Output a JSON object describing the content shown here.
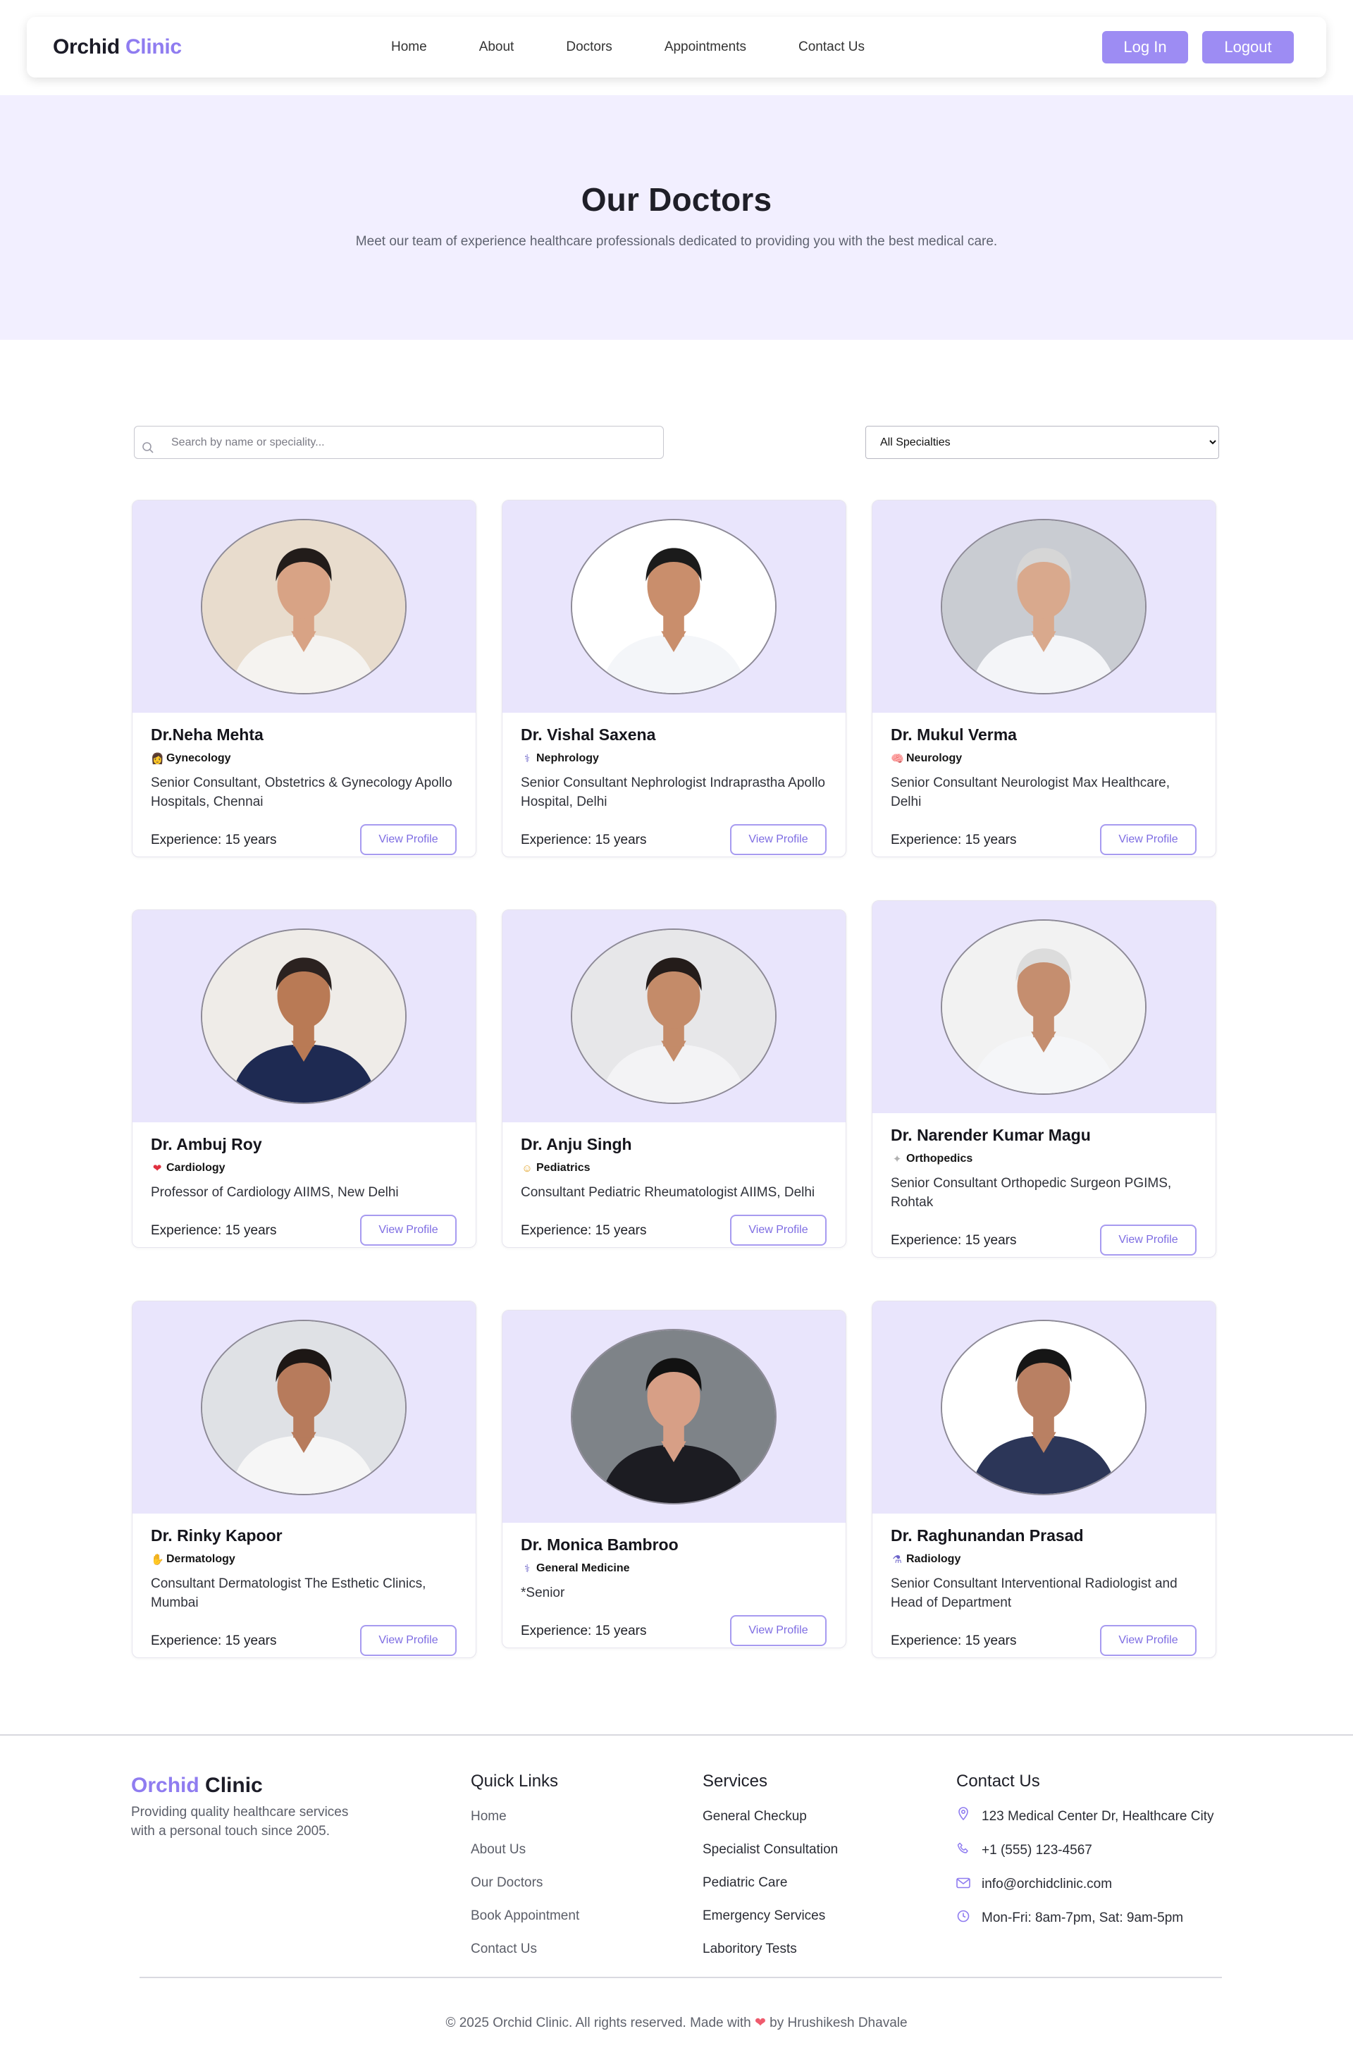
{
  "nav": {
    "brand_main": "Orchid",
    "brand_accent": "Clinic",
    "links": [
      "Home",
      "About",
      "Doctors",
      "Appointments",
      "Contact Us"
    ],
    "login_label": "Log In",
    "logout_label": "Logout"
  },
  "hero": {
    "title": "Our Doctors",
    "subtitle": "Meet our team of experience healthcare professionals dedicated to providing you with the best medical care."
  },
  "filters": {
    "search_placeholder": "Search by name or speciality...",
    "specialty_selected": "All Specialties"
  },
  "doctors": [
    {
      "name": "Dr.Neha Mehta",
      "specialty": "Gynecology",
      "icon": "woman-icon",
      "description": "Senior Consultant, Obstetrics & Gynecology Apollo Hospitals, Chennai",
      "experience": "Experience: 15 years",
      "button": "View Profile"
    },
    {
      "name": "Dr. Vishal Saxena",
      "specialty": "Nephrology",
      "icon": "stethoscope-icon",
      "description": "Senior Consultant Nephrologist Indraprastha Apollo Hospital, Delhi",
      "experience": "Experience: 15 years",
      "button": "View Profile"
    },
    {
      "name": "Dr. Mukul Verma",
      "specialty": "Neurology",
      "icon": "brain-icon",
      "description": "Senior Consultant Neurologist Max Healthcare, Delhi",
      "experience": "Experience: 15 years",
      "button": "View Profile"
    },
    {
      "name": "Dr. Ambuj Roy",
      "specialty": "Cardiology",
      "icon": "heart-icon",
      "description": "Professor of Cardiology AIIMS, New Delhi",
      "experience": "Experience: 15 years",
      "button": "View Profile"
    },
    {
      "name": "Dr. Anju Singh",
      "specialty": "Pediatrics",
      "icon": "child-face-icon",
      "description": "Consultant Pediatric Rheumatologist AIIMS, Delhi",
      "experience": "Experience: 15 years",
      "button": "View Profile"
    },
    {
      "name": "Dr. Narender Kumar Magu",
      "specialty": "Orthopedics",
      "icon": "bone-icon",
      "description": "Senior Consultant Orthopedic Surgeon PGIMS, Rohtak",
      "experience": "Experience: 15 years",
      "button": "View Profile"
    },
    {
      "name": "Dr. Rinky Kapoor",
      "specialty": "Dermatology",
      "icon": "hand-icon",
      "description": "Consultant Dermatologist The Esthetic Clinics, Mumbai",
      "experience": "Experience: 15 years",
      "button": "View Profile"
    },
    {
      "name": "Dr. Monica Bambroo",
      "specialty": "General Medicine",
      "icon": "stethoscope-icon",
      "description": "*Senior",
      "experience": "Experience: 15 years",
      "button": "View Profile"
    },
    {
      "name": "Dr. Raghunandan Prasad",
      "specialty": "Radiology",
      "icon": "microscope-icon",
      "description": "Senior Consultant Interventional Radiologist and Head of Department",
      "experience": "Experience: 15 years",
      "button": "View Profile"
    }
  ],
  "footer": {
    "brand_main": "Orchid",
    "brand_accent": "Clinic",
    "tagline": "Providing quality healthcare services with a personal touch since 2005.",
    "quick_links_title": "Quick Links",
    "quick_links": [
      "Home",
      "About Us",
      "Our Doctors",
      "Book Appointment",
      "Contact Us"
    ],
    "services_title": "Services",
    "services": [
      "General Checkup",
      "Specialist Consultation",
      "Pediatric Care",
      "Emergency Services",
      "Laboritory Tests"
    ],
    "contact_title": "Contact Us",
    "contact": {
      "address": "123 Medical Center Dr, Healthcare City",
      "phone": "+1 (555) 123-4567",
      "email": "info@orchidclinic.com",
      "hours": "Mon-Fri: 8am-7pm, Sat: 9am-5pm"
    },
    "copyright_prefix": "© 2025 Orchid Clinic. All rights reserved. Made with",
    "copyright_suffix": "by Hrushikesh Dhavale"
  },
  "colors": {
    "accent": "#8f7cf0",
    "button": "#9d8cf3",
    "hero_bg": "#f2efff",
    "card_top": "#e9e5fc"
  }
}
